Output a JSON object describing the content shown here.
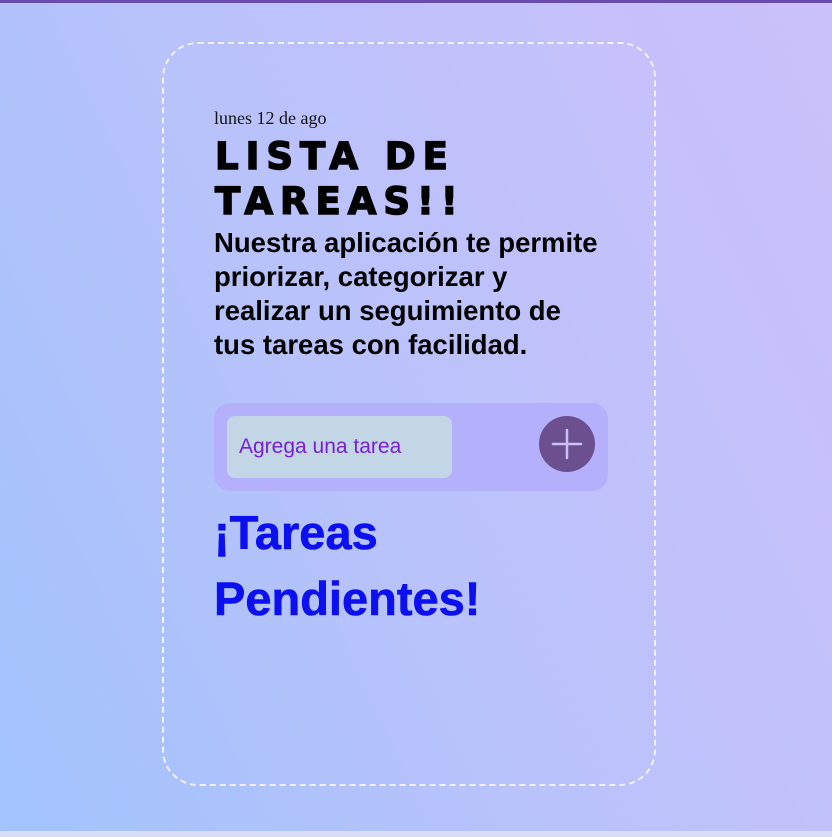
{
  "header": {
    "date": "lunes 12 de ago",
    "title": "LISTA DE TAREAS!!",
    "description": "Nuestra aplicación te permite priorizar, categorizar y realizar un seguimiento de tus tareas con facilidad."
  },
  "task_form": {
    "placeholder": "Agrega una tarea",
    "value": "",
    "add_icon": "plus-icon"
  },
  "pending": {
    "heading": "¡Tareas Pendientes!"
  },
  "colors": {
    "accent_bar": "#6a4bb0",
    "input_panel": "#b5b0fb",
    "input_field": "#c2d6e6",
    "placeholder_text": "#7a1fd6",
    "add_button": "#6b4f8f",
    "pending_heading": "#0c0ff0"
  }
}
